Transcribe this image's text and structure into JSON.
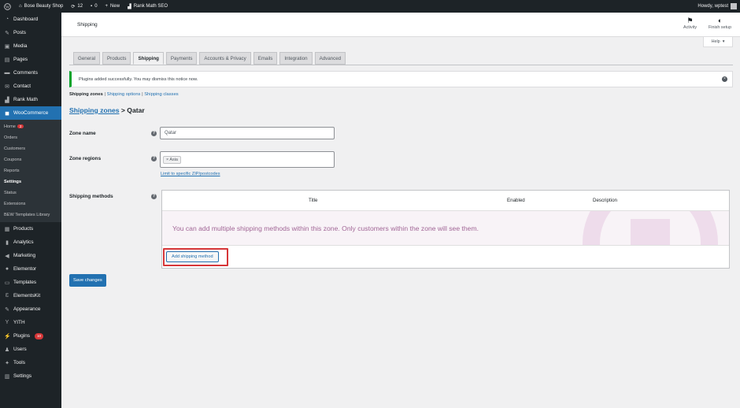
{
  "admin_bar": {
    "site_name": "Bose Beauty Shop",
    "updates_count": "12",
    "comments_count": "0",
    "new_label": "New",
    "rank_math_label": "Rank Math SEO",
    "greeting": "Howdy, wptest"
  },
  "sidebar": {
    "items": [
      {
        "icon": "dashboard-icon",
        "label": "Dashboard"
      },
      {
        "icon": "pin-icon",
        "label": "Posts"
      },
      {
        "icon": "media-icon",
        "label": "Media"
      },
      {
        "icon": "pages-icon",
        "label": "Pages"
      },
      {
        "icon": "comment-icon",
        "label": "Comments"
      },
      {
        "icon": "mail-icon",
        "label": "Contact"
      },
      {
        "icon": "chart-icon",
        "label": "Rank Math"
      },
      {
        "icon": "woo-icon",
        "label": "WooCommerce"
      }
    ],
    "woo_submenu": [
      {
        "label": "Home",
        "badge": "2"
      },
      {
        "label": "Orders"
      },
      {
        "label": "Customers"
      },
      {
        "label": "Coupons"
      },
      {
        "label": "Reports"
      },
      {
        "label": "Settings"
      },
      {
        "label": "Status"
      },
      {
        "label": "Extensions"
      },
      {
        "label": "BEW Templates Library"
      }
    ],
    "items_after": [
      {
        "icon": "archive-icon",
        "label": "Products"
      },
      {
        "icon": "bar-chart-icon",
        "label": "Analytics"
      },
      {
        "icon": "megaphone-icon",
        "label": "Marketing"
      },
      {
        "icon": "elementor-icon",
        "label": "Elementor"
      },
      {
        "icon": "folder-icon",
        "label": "Templates"
      },
      {
        "icon": "ek-icon",
        "label": "ElementsKit"
      },
      {
        "icon": "brush-icon",
        "label": "Appearance"
      },
      {
        "icon": "yith-icon",
        "label": "YITH"
      },
      {
        "icon": "plug-icon",
        "label": "Plugins",
        "badge": "10"
      },
      {
        "icon": "user-icon",
        "label": "Users"
      },
      {
        "icon": "wrench-icon",
        "label": "Tools"
      },
      {
        "icon": "settings-icon",
        "label": "Settings"
      }
    ]
  },
  "header": {
    "title": "Shipping",
    "activity_label": "Activity",
    "finish_setup_label": "Finish setup",
    "help_label": "Help"
  },
  "tabs": [
    "General",
    "Products",
    "Shipping",
    "Payments",
    "Accounts & Privacy",
    "Emails",
    "Integration",
    "Advanced"
  ],
  "active_tab": "Shipping",
  "notice": {
    "text": "Plugins added successfully. You may dismiss this notice now."
  },
  "subnav": {
    "current": "Shipping zones",
    "sep1": " | ",
    "options": "Shipping options",
    "sep2": " | ",
    "classes": "Shipping classes"
  },
  "breadcrumb": {
    "link": "Shipping zones",
    "separator": " > ",
    "current": "Qatar"
  },
  "form": {
    "zone_name_label": "Zone name",
    "zone_name_value": "Qatar",
    "zone_regions_label": "Zone regions",
    "region_chip": "× Asia",
    "limit_link": "Limit to specific ZIP/postcodes",
    "shipping_methods_label": "Shipping methods"
  },
  "methods_table": {
    "headers": [
      "Title",
      "Enabled",
      "Description"
    ],
    "empty_message": "You can add multiple shipping methods within this zone. Only customers within the zone will see them.",
    "add_button": "Add shipping method"
  },
  "save_button": "Save changes",
  "colors": {
    "accent": "#2271b1",
    "woo_purple": "#a16696",
    "notice_success": "#00a32a",
    "highlight": "#d63638"
  }
}
